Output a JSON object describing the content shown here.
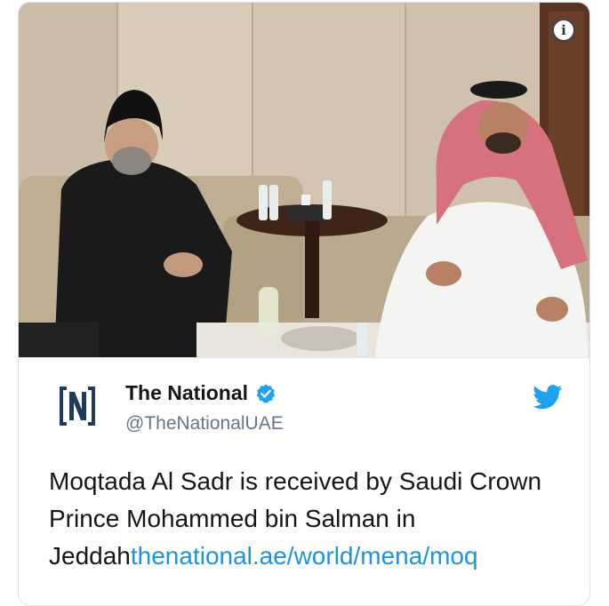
{
  "photo": {
    "description_icon": "info-icon",
    "info_label": "i"
  },
  "tweet": {
    "display_name": "The National",
    "verified_icon": "verified-badge-icon",
    "handle": "@TheNationalUAE",
    "brand_icon": "twitter-bird-icon",
    "avatar_icon": "the-national-logo",
    "text": "Moqtada Al Sadr is received by Saudi Crown Prince Mohammed bin Salman in Jeddah",
    "link": "thenational.ae/world/mena/moq"
  },
  "colors": {
    "link": "#1b95e0",
    "twitter_blue": "#1da1f2",
    "text": "#14171a",
    "secondary": "#657786"
  }
}
